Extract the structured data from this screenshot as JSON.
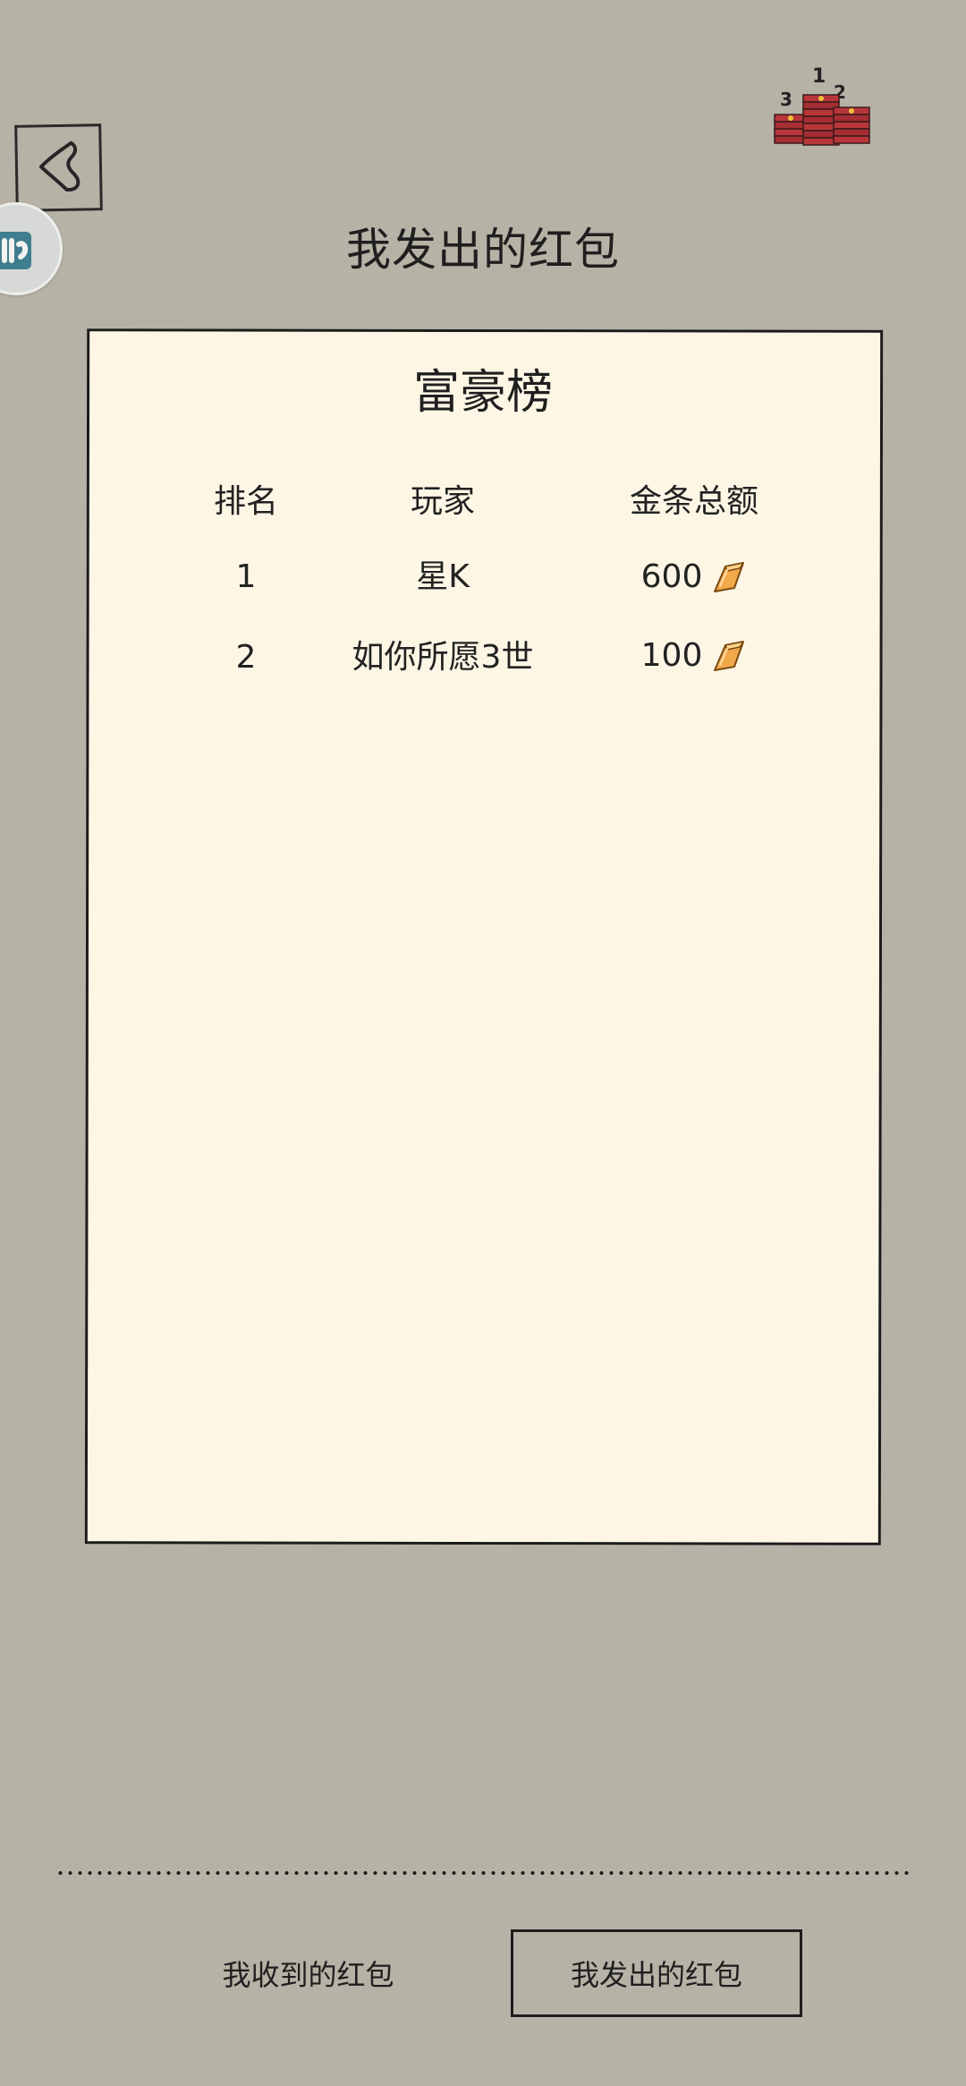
{
  "header": {
    "title": "我发出的红包",
    "back_icon": "chevron-left-icon",
    "podium_icon": "red-envelope-podium-icon",
    "podium_ranks": [
      "3",
      "1",
      "2"
    ]
  },
  "leaderboard": {
    "title": "富豪榜",
    "columns": [
      "排名",
      "玩家",
      "金条总额"
    ],
    "rows": [
      {
        "rank": "1",
        "player": "星K",
        "amount": "600"
      },
      {
        "rank": "2",
        "player": "如你所愿3世",
        "amount": "100"
      }
    ],
    "amount_icon": "gold-bar-icon"
  },
  "tabs": {
    "received": "我收到的红包",
    "sent": "我发出的红包",
    "active": "sent"
  },
  "colors": {
    "background": "#b6b2a6",
    "panel": "#fdf6e5",
    "border": "#1c1c1c",
    "gold": "#f0a640",
    "envelope_red": "#b8363a"
  }
}
